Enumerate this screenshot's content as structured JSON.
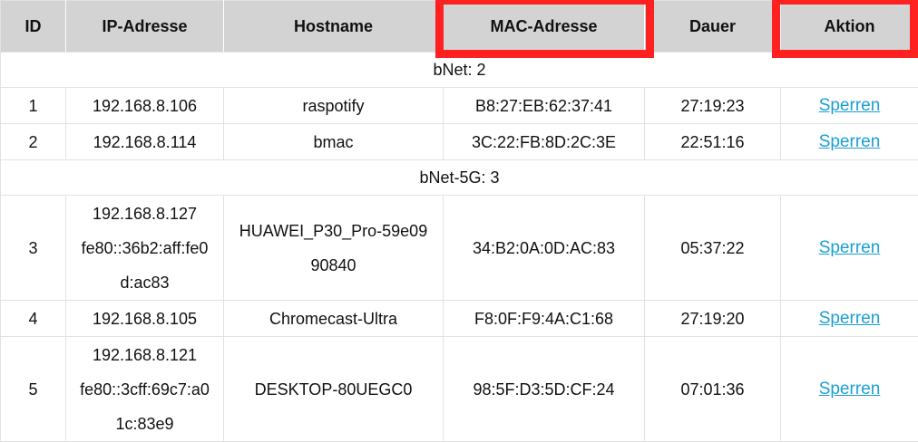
{
  "columns": [
    "ID",
    "IP-Adresse",
    "Hostname",
    "MAC-Adresse",
    "Dauer",
    "Aktion"
  ],
  "groups": [
    {
      "label": "bNet:  2",
      "rows": [
        {
          "id": "1",
          "ip": [
            "192.168.8.106"
          ],
          "hostname": [
            "raspotify"
          ],
          "mac": "B8:27:EB:62:37:41",
          "duration": "27:19:23",
          "action": "Sperren"
        },
        {
          "id": "2",
          "ip": [
            "192.168.8.114"
          ],
          "hostname": [
            "bmac"
          ],
          "mac": "3C:22:FB:8D:2C:3E",
          "duration": "22:51:16",
          "action": "Sperren"
        }
      ]
    },
    {
      "label": "bNet-5G:  3",
      "rows": [
        {
          "id": "3",
          "ip": [
            "192.168.8.127",
            "fe80::36b2:aff:fe0",
            "d:ac83"
          ],
          "hostname": [
            "HUAWEI_P30_Pro-59e09",
            "90840"
          ],
          "mac": "34:B2:0A:0D:AC:83",
          "duration": "05:37:22",
          "action": "Sperren"
        },
        {
          "id": "4",
          "ip": [
            "192.168.8.105"
          ],
          "hostname": [
            "Chromecast-Ultra"
          ],
          "mac": "F8:0F:F9:4A:C1:68",
          "duration": "27:19:20",
          "action": "Sperren"
        },
        {
          "id": "5",
          "ip": [
            "192.168.8.121",
            "fe80::3cff:69c7:a0",
            "1c:83e9"
          ],
          "hostname": [
            "DESKTOP-80UEGC0"
          ],
          "mac": "98:5F:D3:5D:CF:24",
          "duration": "07:01:36",
          "action": "Sperren"
        }
      ]
    }
  ],
  "highlight_color": "#ff2020",
  "link_color": "#1a9fd4",
  "header_bg": "#d3d3d3"
}
